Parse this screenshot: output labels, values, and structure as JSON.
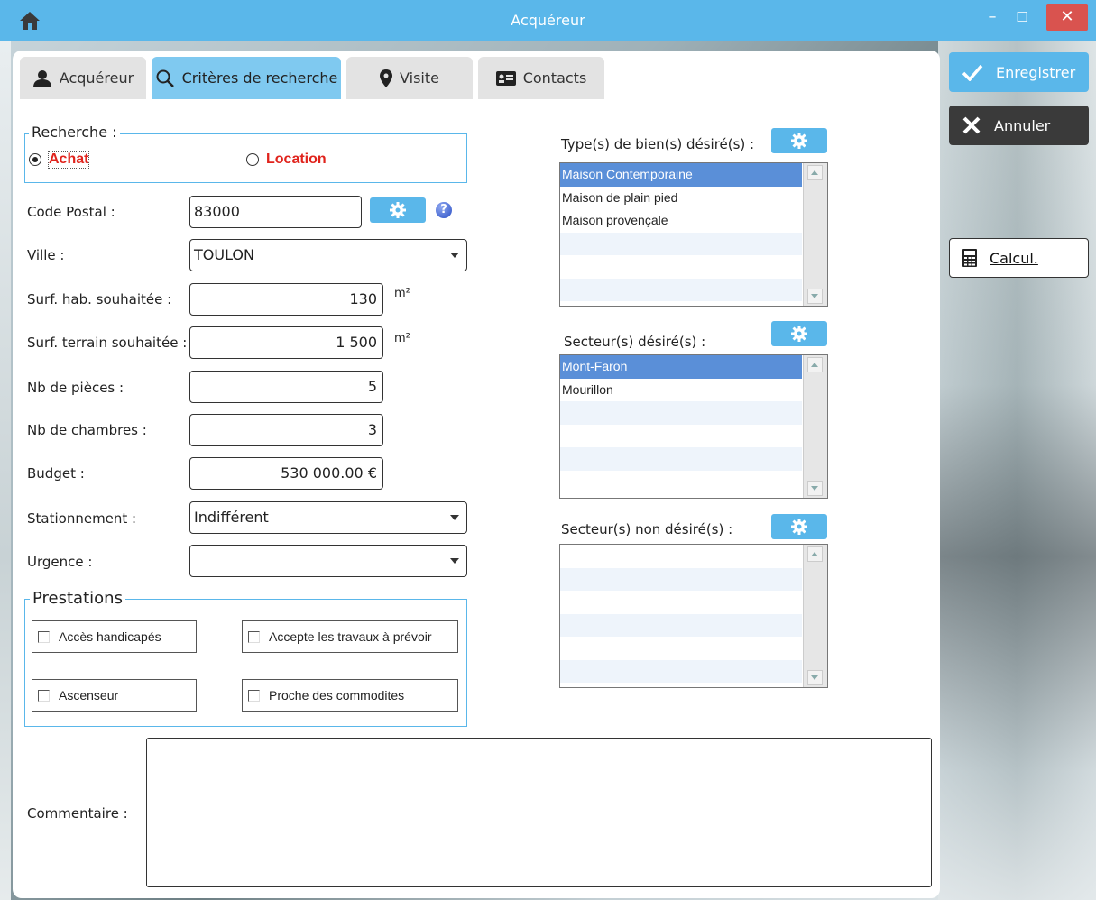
{
  "window": {
    "title": "Acquéreur",
    "controls": {
      "minimize": "–",
      "maximize": "☐",
      "close": "✕"
    }
  },
  "tabs": [
    {
      "label": "Acquéreur",
      "icon": "person-icon",
      "active": false
    },
    {
      "label": "Critères de recherche",
      "icon": "search-icon",
      "active": true
    },
    {
      "label": "Visite",
      "icon": "map-pin-icon",
      "active": false
    },
    {
      "label": "Contacts",
      "icon": "contact-card-icon",
      "active": false
    }
  ],
  "sidebar": {
    "save_label": "Enregistrer",
    "cancel_label": "Annuler",
    "calc_label": "Calcul."
  },
  "recherche": {
    "legend": "Recherche :",
    "option_achat": "Achat",
    "option_location": "Location",
    "selected": "Achat"
  },
  "form": {
    "code_postal": {
      "label": "Code Postal :",
      "value": "83000"
    },
    "ville": {
      "label": "Ville :",
      "value": "TOULON"
    },
    "surf_hab": {
      "label": "Surf. hab. souhaitée :",
      "value": "130",
      "unit": "m²"
    },
    "surf_terrain": {
      "label": "Surf. terrain souhaitée :",
      "value": "1 500",
      "unit": "m²"
    },
    "nb_pieces": {
      "label": "Nb de pièces :",
      "value": "5"
    },
    "nb_chambres": {
      "label": "Nb de chambres :",
      "value": "3"
    },
    "budget": {
      "label": "Budget :",
      "value": "530 000.00 €"
    },
    "stationnement": {
      "label": "Stationnement :",
      "value": "Indifférent"
    },
    "urgence": {
      "label": "Urgence :",
      "value": ""
    },
    "commentaire": {
      "label": "Commentaire :",
      "value": ""
    }
  },
  "prestations": {
    "legend": "Prestations",
    "items": [
      {
        "label": "Accès handicapés",
        "checked": false
      },
      {
        "label": "Accepte les travaux à prévoir",
        "checked": false
      },
      {
        "label": "Ascenseur",
        "checked": false
      },
      {
        "label": "Proche des commodites",
        "checked": false
      }
    ]
  },
  "lists": {
    "types_bien": {
      "label": "Type(s) de bien(s) désiré(s) :",
      "items": [
        "Maison Contemporaine",
        "Maison de plain pied",
        "Maison provençale"
      ],
      "selected": 0
    },
    "secteurs_desires": {
      "label": "Secteur(s) désiré(s) :",
      "items": [
        "Mont-Faron",
        "Mourillon"
      ],
      "selected": 0
    },
    "secteurs_non_desires": {
      "label": "Secteur(s) non désiré(s) :",
      "items": []
    }
  },
  "colors": {
    "accent": "#5ab7ea",
    "selection": "#5a8fd8",
    "warning_text": "#e0231c"
  }
}
